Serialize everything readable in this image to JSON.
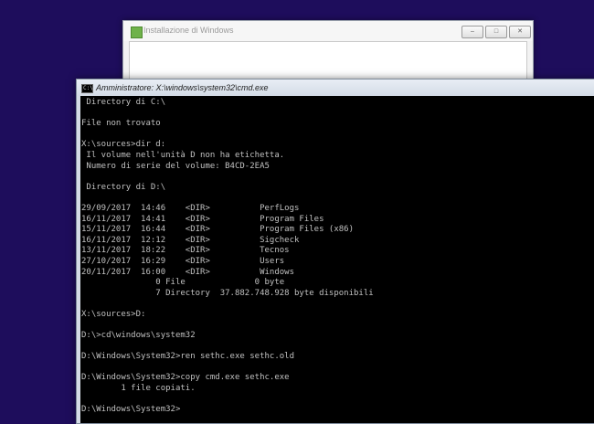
{
  "setup_window": {
    "title": "Installazione di Windows",
    "buttons": {
      "minimize_glyph": "–",
      "maximize_glyph": "□",
      "close_glyph": "✕"
    }
  },
  "cmd_window": {
    "title": "Amministratore: X:\\windows\\system32\\cmd.exe",
    "icon_glyph": "C:\\",
    "lines": [
      " Directory di C:\\",
      "",
      "File non trovato",
      "",
      "X:\\sources>dir d:",
      " Il volume nell'unità D non ha etichetta.",
      " Numero di serie del volume: B4CD-2EA5",
      "",
      " Directory di D:\\",
      "",
      "29/09/2017  14:46    <DIR>          PerfLogs",
      "16/11/2017  14:41    <DIR>          Program Files",
      "15/11/2017  16:44    <DIR>          Program Files (x86)",
      "16/11/2017  12:12    <DIR>          Sigcheck",
      "13/11/2017  18:22    <DIR>          Tecnos",
      "27/10/2017  16:29    <DIR>          Users",
      "20/11/2017  16:00    <DIR>          Windows",
      "               0 File              0 byte",
      "               7 Directory  37.882.748.928 byte disponibili",
      "",
      "X:\\sources>D:",
      "",
      "D:\\>cd\\windows\\system32",
      "",
      "D:\\Windows\\System32>ren sethc.exe sethc.old",
      "",
      "D:\\Windows\\System32>copy cmd.exe sethc.exe",
      "        1 file copiati.",
      "",
      "D:\\Windows\\System32>"
    ]
  },
  "colors": {
    "desktop": "#1e0d5c",
    "console_bg": "#000000",
    "console_text": "#c0c0c0"
  }
}
